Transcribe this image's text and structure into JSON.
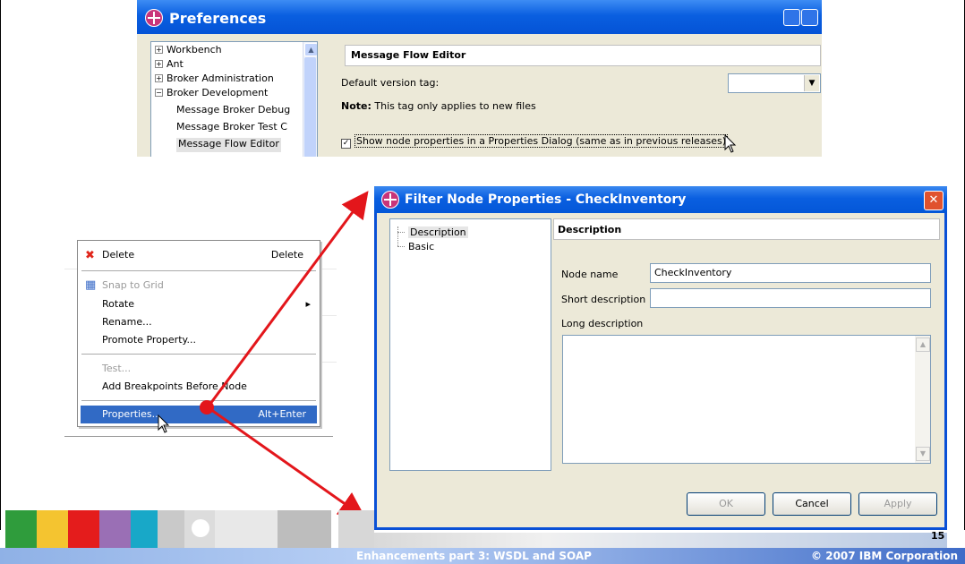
{
  "preferences": {
    "title": "Preferences",
    "tree": [
      {
        "label": "Workbench",
        "expander": "+"
      },
      {
        "label": "Ant",
        "expander": "+"
      },
      {
        "label": "Broker Administration",
        "expander": "+"
      },
      {
        "label": "Broker Development",
        "expander": "−"
      },
      {
        "label": "Message Broker Debug",
        "expander": ""
      },
      {
        "label": "Message Broker Test C",
        "expander": ""
      },
      {
        "label": "Message Flow Editor",
        "expander": ""
      }
    ],
    "panel_title": "Message Flow Editor",
    "default_version_label": "Default version tag:",
    "default_version_value": "",
    "note_bold": "Note:",
    "note_text": "This tag only applies to new files",
    "checkbox_label": "Show node properties in a Properties Dialog (same as in previous releases)",
    "checkbox_checked": "✓"
  },
  "context_menu": {
    "items": [
      {
        "label": "Delete",
        "accel": "Delete",
        "icon": "delete-x-icon"
      },
      {
        "label": "Snap to Grid",
        "accel": "",
        "icon": "grid-icon"
      },
      {
        "label": "Rotate",
        "accel": "▸"
      },
      {
        "label": "Rename...",
        "accel": ""
      },
      {
        "label": "Promote Property...",
        "accel": ""
      },
      {
        "label": "Test...",
        "accel": ""
      },
      {
        "label": "Add Breakpoints Before Node",
        "accel": ""
      },
      {
        "label": "Properties...",
        "accel": "Alt+Enter"
      }
    ]
  },
  "dialog": {
    "title": "Filter Node Properties - CheckInventory",
    "tree": [
      "Description",
      "Basic"
    ],
    "panel_title": "Description",
    "node_name_label": "Node name",
    "node_name_value": "CheckInventory",
    "short_desc_label": "Short description",
    "short_desc_value": "",
    "long_desc_label": "Long description",
    "buttons": {
      "ok": "OK",
      "cancel": "Cancel",
      "apply": "Apply"
    }
  },
  "footer": {
    "title": "Enhancements part 3: WSDL and SOAP",
    "copyright": "© 2007 IBM Corporation",
    "page_number": "15"
  },
  "colors": {
    "titlebar": "#0a5fe0",
    "selection": "#316ac5",
    "arrow": "#e3161b"
  }
}
